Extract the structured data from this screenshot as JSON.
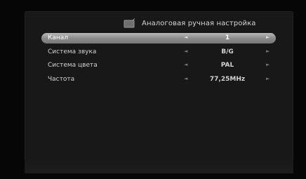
{
  "header": {
    "title": "Аналоговая ручная настройка",
    "icon": "tv-icon"
  },
  "settings": {
    "rows": [
      {
        "label": "Канал",
        "value": "1",
        "selected": true
      },
      {
        "label": "Система звука",
        "value": "B/G",
        "selected": false
      },
      {
        "label": "Система цвета",
        "value": "PAL",
        "selected": false
      },
      {
        "label": "Частота",
        "value": "77,25MHz",
        "selected": false
      }
    ],
    "arrow_left": "◄",
    "arrow_right": "►"
  },
  "colors": {
    "panel_background": "#181818",
    "highlight": "#9a9a9a",
    "text": "#d2d2d2"
  }
}
